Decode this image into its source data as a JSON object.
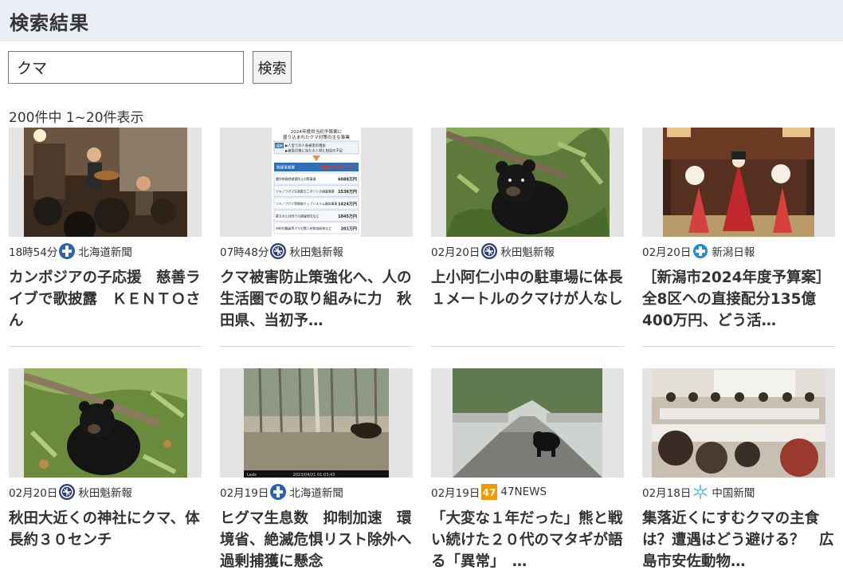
{
  "header": {
    "title": "検索結果"
  },
  "search": {
    "value": "クマ",
    "button_label": "検索"
  },
  "result_summary": "200件中 1~20件表示",
  "results": [
    {
      "time": "18時54分",
      "source": "北海道新聞",
      "icon": "hokkaido-shimbun-logo-icon",
      "title": "カンボジアの子応援　慈善ライブで歌披露　ＫＥＮＴＯさん"
    },
    {
      "time": "07時48分",
      "source": "秋田魁新報",
      "icon": "akita-sakigake-logo-icon",
      "title": "クマ被害防止策強化へ、人の生活圏での取り組みに力　秋田県、当初予…"
    },
    {
      "time": "02月20日",
      "source": "秋田魁新報",
      "icon": "akita-sakigake-logo-icon",
      "title": "上小阿仁小中の駐車場に体長１メートルのクマけが人なし"
    },
    {
      "time": "02月20日",
      "source": "新潟日報",
      "icon": "niigata-nippo-logo-icon",
      "title": "［新潟市2024年度予算案］全8区への直接配分135億400万円、どう活…"
    },
    {
      "time": "02月20日",
      "source": "秋田魁新報",
      "icon": "akita-sakigake-logo-icon",
      "title": "秋田大近くの神社にクマ、体長約３０センチ"
    },
    {
      "time": "02月19日",
      "source": "北海道新聞",
      "icon": "hokkaido-shimbun-logo-icon",
      "title": "ヒグマ生息数　抑制加速　環境省、絶滅危惧リスト除外へ　過剰捕獲に懸念"
    },
    {
      "time": "02月19日",
      "source": "47NEWS",
      "icon": "47news-logo-icon",
      "icon_text": "47",
      "title": "「大変な１年だった」熊と戦い続けた２０代のマタギが語る「異常」　…"
    },
    {
      "time": "02月18日",
      "source": "中国新聞",
      "icon": "chugoku-shimbun-logo-icon",
      "title": "集落近くにすむクマの主食は？遭遇はどう避ける？　広島市安佐動物…"
    }
  ],
  "infographic": {
    "heading_line1": "2024年度県当初予算案に",
    "heading_line2": "盛り込まれたクマ対策の主な事業",
    "tag": "課題",
    "issue1": "▶人里での人身被害の増加",
    "issue2": "▶被害対策に当たる人材と知見の不足",
    "total_label": "関連事業費",
    "total_value": "2億1994万円",
    "rows": [
      {
        "label": "農作物鳥獣被害防止対策事業",
        "value": "6088万円"
      },
      {
        "label": "ツキノワグマ生息数モニタリング調査事業",
        "value": "1536万円"
      },
      {
        "label": "ツキノワグマ等情報マップシステム開発事業",
        "value": "1424万円"
      },
      {
        "label": "県立大と共同での調査研究など",
        "value": "1045万円"
      },
      {
        "label": "市町村職員等クマ対策人材育成研修など",
        "value": "201万円"
      }
    ]
  },
  "trailcam": {
    "left": "Ledx",
    "mid": "2023/04/21 01:03:43"
  },
  "colors": {
    "header_bg": "#eaeef4",
    "hokkaido_blue": "#2a62b4",
    "akita_navy": "#2b3e72",
    "niigata_blue": "#2b88d8",
    "news47_orange": "#f39800",
    "chugoku_lightblue": "#6fc3ea"
  }
}
